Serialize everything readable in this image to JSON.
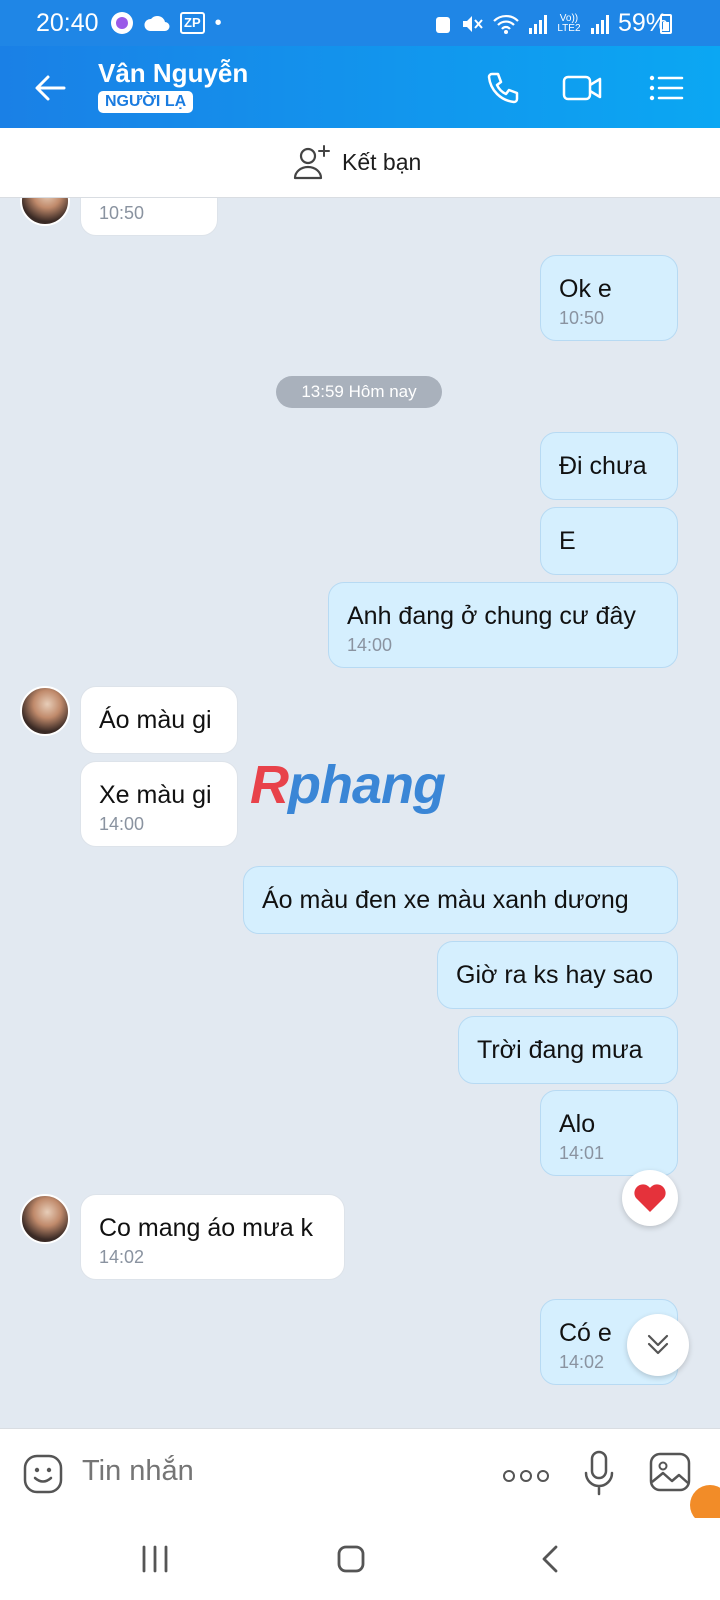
{
  "status_bar": {
    "time": "20:40",
    "battery": "59%",
    "icons": [
      "messenger-icon",
      "cloud-icon",
      "zp-icon",
      "dot-icon",
      "recycle-icon",
      "mute-icon",
      "wifi-icon",
      "signal-icon",
      "volte-icon",
      "signal-icon",
      "battery-icon"
    ],
    "zp_label": "ZP",
    "volte_label": "Vo)) LTE2"
  },
  "header": {
    "contact_name": "Vân Nguyễn",
    "badge": "NGƯỜI LẠ",
    "icons": [
      "back-arrow-icon",
      "phone-icon",
      "video-call-icon",
      "menu-icon"
    ]
  },
  "friend_bar": {
    "label": "Kết bạn",
    "icon": "add-user-icon"
  },
  "date_chip": "13:59 Hôm nay",
  "messages": [
    {
      "dir": "in",
      "text": "",
      "time": "10:50"
    },
    {
      "dir": "out",
      "text": "Ok e",
      "time": "10:50"
    },
    {
      "dir": "out",
      "text": "Đi chưa",
      "time": ""
    },
    {
      "dir": "out",
      "text": "E",
      "time": ""
    },
    {
      "dir": "out",
      "text": "Anh đang ở chung cư đây",
      "time": "14:00"
    },
    {
      "dir": "in",
      "text": "Áo màu gi",
      "time": ""
    },
    {
      "dir": "in",
      "text": "Xe màu gi",
      "time": "14:00"
    },
    {
      "dir": "out",
      "text": "Áo màu đen xe màu xanh dương",
      "time": ""
    },
    {
      "dir": "out",
      "text": "Giờ ra ks hay sao",
      "time": ""
    },
    {
      "dir": "out",
      "text": "Trời đang mưa",
      "time": ""
    },
    {
      "dir": "out",
      "text": "Alo",
      "time": "14:01"
    },
    {
      "dir": "in",
      "text": "Co mang áo mưa k",
      "time": "14:02"
    },
    {
      "dir": "out",
      "text": "Có e",
      "time": "14:02"
    }
  ],
  "watermark": {
    "first": "R",
    "rest": "phang"
  },
  "composer": {
    "placeholder": "Tin nhắn",
    "icons": [
      "emoji-icon",
      "more-icon",
      "mic-icon",
      "gallery-icon"
    ]
  },
  "nav_bar": {
    "icons": [
      "recent-apps-icon",
      "home-icon",
      "nav-back-icon"
    ]
  },
  "colors": {
    "header": "#1a80e6",
    "outgoing_bubble": "#d5effe",
    "incoming_bubble": "#ffffff",
    "chat_bg": "#e2e9f1"
  }
}
